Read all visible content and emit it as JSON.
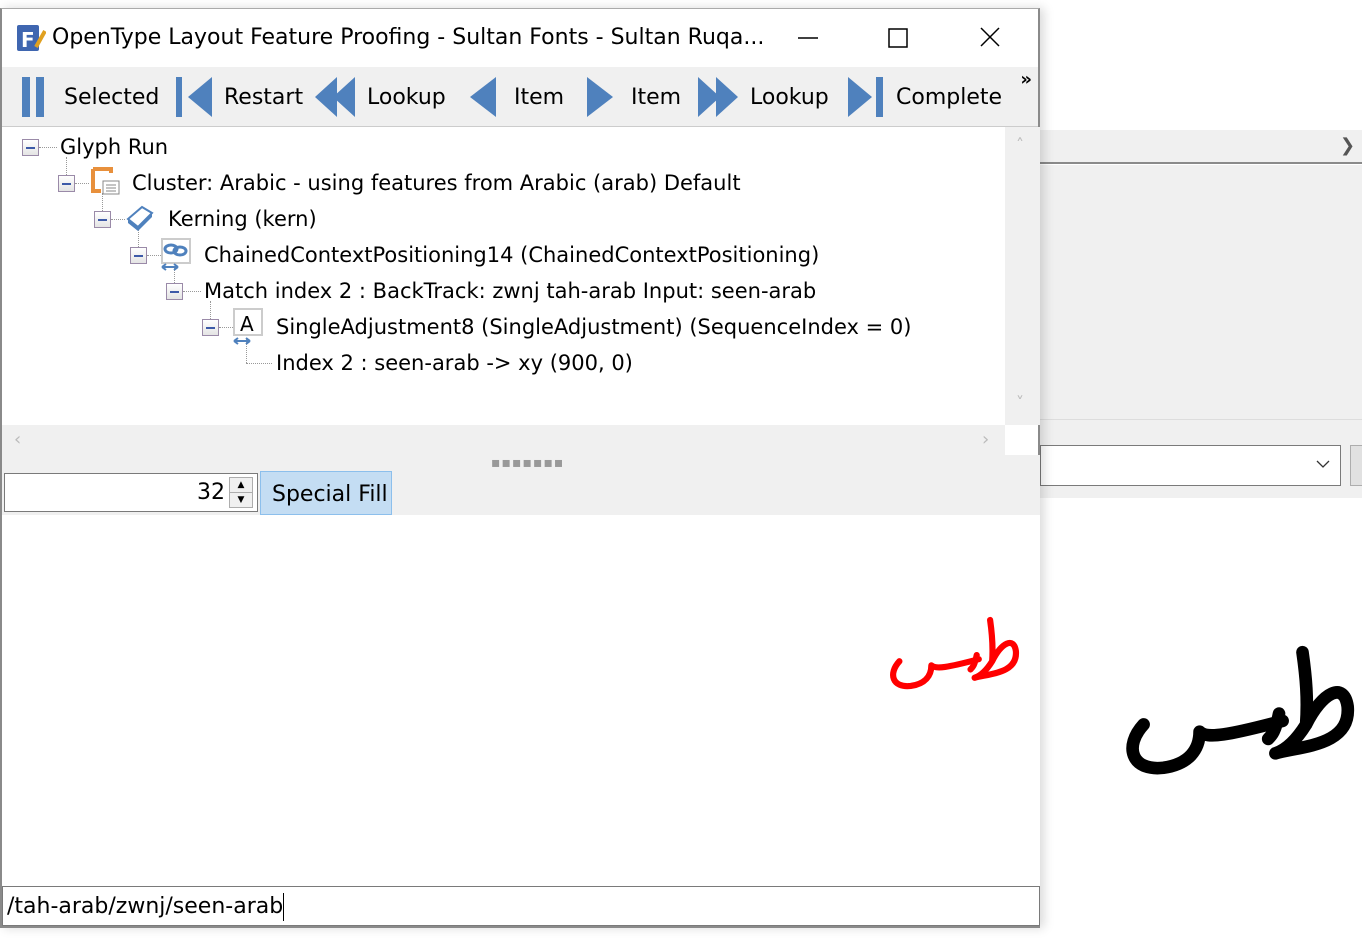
{
  "window": {
    "title": "OpenType Layout Feature Proofing - Sultan Fonts - Sultan Ruqa...",
    "minimize_icon": "minimize-icon",
    "maximize_icon": "maximize-icon",
    "close_icon": "close-icon"
  },
  "toolbar": {
    "items": [
      {
        "label": "Selected",
        "icon": "pause-icon"
      },
      {
        "label": "Restart",
        "icon": "skip-to-start-icon"
      },
      {
        "label": "Lookup",
        "icon": "rewind-icon"
      },
      {
        "label": "Item",
        "icon": "step-back-icon"
      },
      {
        "label": "Item",
        "icon": "step-forward-icon"
      },
      {
        "label": "Lookup",
        "icon": "fast-forward-icon"
      },
      {
        "label": "Complete",
        "icon": "skip-to-end-icon"
      }
    ],
    "overflow": "»",
    "accent": "#4f81bd"
  },
  "tree": {
    "nodes": [
      {
        "label": "Glyph Run"
      },
      {
        "label": "Cluster: Arabic - using features from Arabic (arab) Default",
        "icon": "cluster-icon"
      },
      {
        "label": "Kerning (kern)",
        "icon": "eraser-icon"
      },
      {
        "label": "ChainedContextPositioning14 (ChainedContextPositioning)",
        "icon": "chained-context-icon"
      },
      {
        "label": "Match index 2 : BackTrack: zwnj tah-arab Input: seen-arab"
      },
      {
        "label": "SingleAdjustment8 (SingleAdjustment) (SequenceIndex = 0)",
        "icon": "single-adjustment-icon"
      },
      {
        "label": "Index 2 : seen-arab -> xy (900, 0)"
      }
    ]
  },
  "controls": {
    "size_value": "32",
    "special_fill_label": "Special Fill"
  },
  "preview": {
    "glyph_color_selected": "#ff0000",
    "glyph_color_main": "#000000"
  },
  "input": {
    "glyph_string": "/tah-arab/zwnj/seen-arab"
  }
}
